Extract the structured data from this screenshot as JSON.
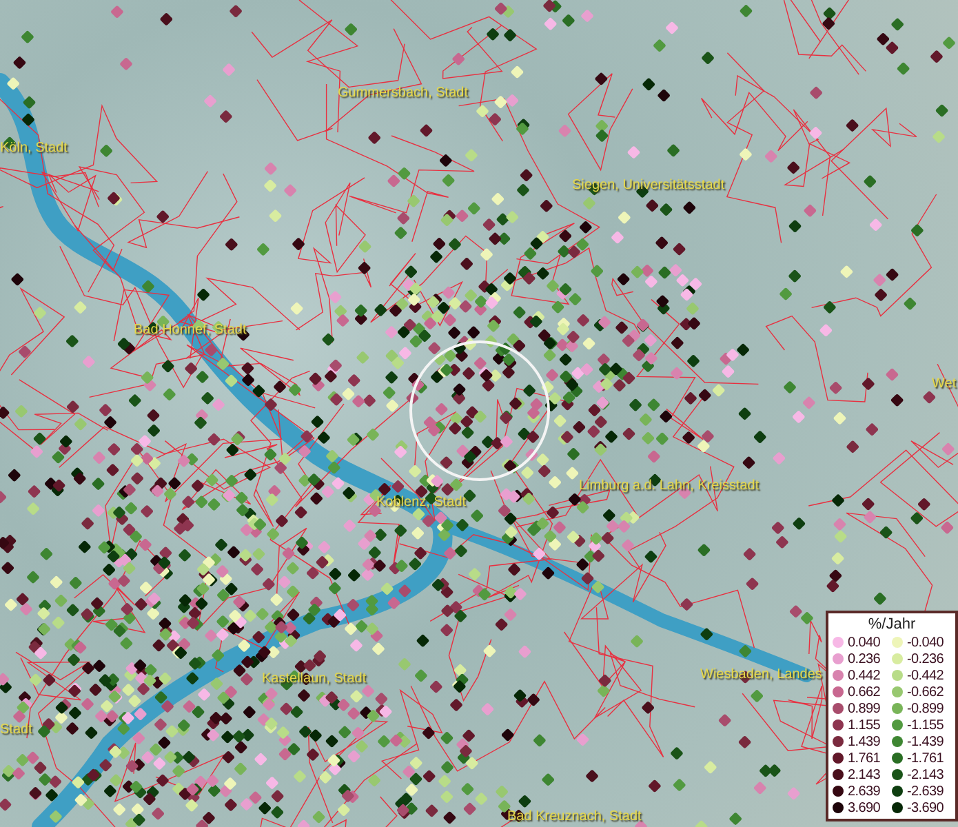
{
  "map_labels": [
    {
      "text": "Gummersbach, Stadt"
    },
    {
      "text": "Köln, Stadt"
    },
    {
      "text": "Siegen, Universitätsstadt"
    },
    {
      "text": "Bad Honnef, Stadt"
    },
    {
      "text": "Wet"
    },
    {
      "text": "Koblenz, Stadt"
    },
    {
      "text": "Limburg a.d. Lahn, Kreisstadt"
    },
    {
      "text": "Kastellaun, Stadt"
    },
    {
      "text": "Wiesbaden, Landes"
    },
    {
      "text": "Stadt"
    },
    {
      "text": "Bad Kreuznach, Stadt"
    }
  ],
  "legend": {
    "title": "%/Jahr",
    "rows": [
      {
        "positive": {
          "label": "0.040",
          "color": "#f7b8e6"
        },
        "negative": {
          "label": "-0.040",
          "color": "#eef5b8"
        }
      },
      {
        "positive": {
          "label": "0.236",
          "color": "#e89fcf"
        },
        "negative": {
          "label": "-0.236",
          "color": "#d8eca0"
        }
      },
      {
        "positive": {
          "label": "0.442",
          "color": "#d883ae"
        },
        "negative": {
          "label": "-0.442",
          "color": "#b8dc88"
        }
      },
      {
        "positive": {
          "label": "0.662",
          "color": "#c86890"
        },
        "negative": {
          "label": "-0.662",
          "color": "#98c870"
        }
      },
      {
        "positive": {
          "label": "0.899",
          "color": "#a84c6c"
        },
        "negative": {
          "label": "-0.899",
          "color": "#78b458"
        }
      },
      {
        "positive": {
          "label": "1.155",
          "color": "#8e3550"
        },
        "negative": {
          "label": "-1.155",
          "color": "#529a40"
        }
      },
      {
        "positive": {
          "label": "1.439",
          "color": "#7a2a3e"
        },
        "negative": {
          "label": "-1.439",
          "color": "#3e8632"
        }
      },
      {
        "positive": {
          "label": "1.761",
          "color": "#62182a"
        },
        "negative": {
          "label": "-1.761",
          "color": "#2a6e24"
        }
      },
      {
        "positive": {
          "label": "2.143",
          "color": "#4a0f1c"
        },
        "negative": {
          "label": "-2.143",
          "color": "#1a5418"
        }
      },
      {
        "positive": {
          "label": "2.639",
          "color": "#360812"
        },
        "negative": {
          "label": "-2.639",
          "color": "#0e3e10"
        }
      },
      {
        "positive": {
          "label": "3.690",
          "color": "#1e040a"
        },
        "negative": {
          "label": "-3.690",
          "color": "#062806"
        }
      }
    ]
  }
}
